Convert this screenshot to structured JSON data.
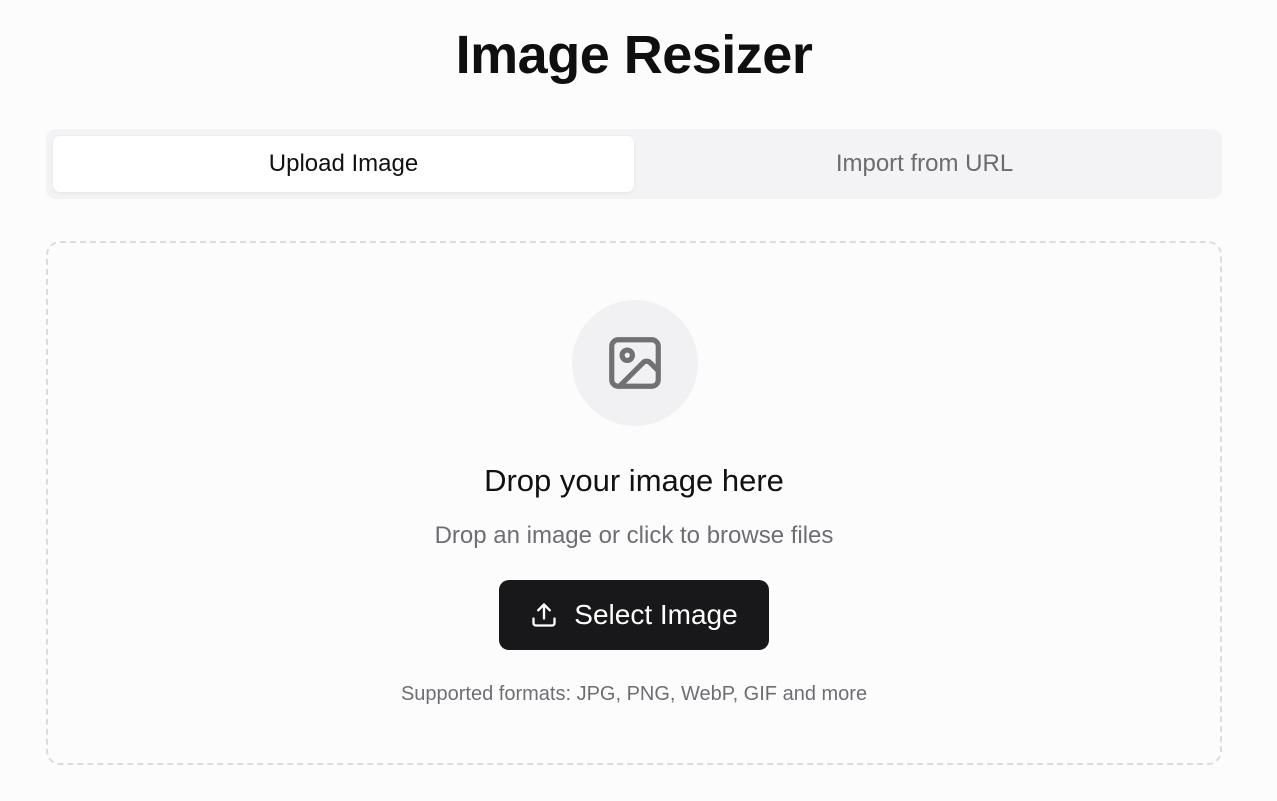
{
  "header": {
    "title": "Image Resizer"
  },
  "tabs": [
    {
      "label": "Upload Image",
      "active": true
    },
    {
      "label": "Import from URL",
      "active": false
    }
  ],
  "dropzone": {
    "icon": "image-icon",
    "heading": "Drop your image here",
    "subtext": "Drop an image or click to browse files",
    "button": {
      "label": "Select Image",
      "icon": "upload-icon"
    },
    "formats_note": "Supported formats: JPG, PNG, WebP, GIF and more"
  },
  "colors": {
    "background": "#fdfcfd",
    "button_bg": "#18181a",
    "muted_text": "#6f6d72",
    "tab_track": "#f3f2f4"
  }
}
